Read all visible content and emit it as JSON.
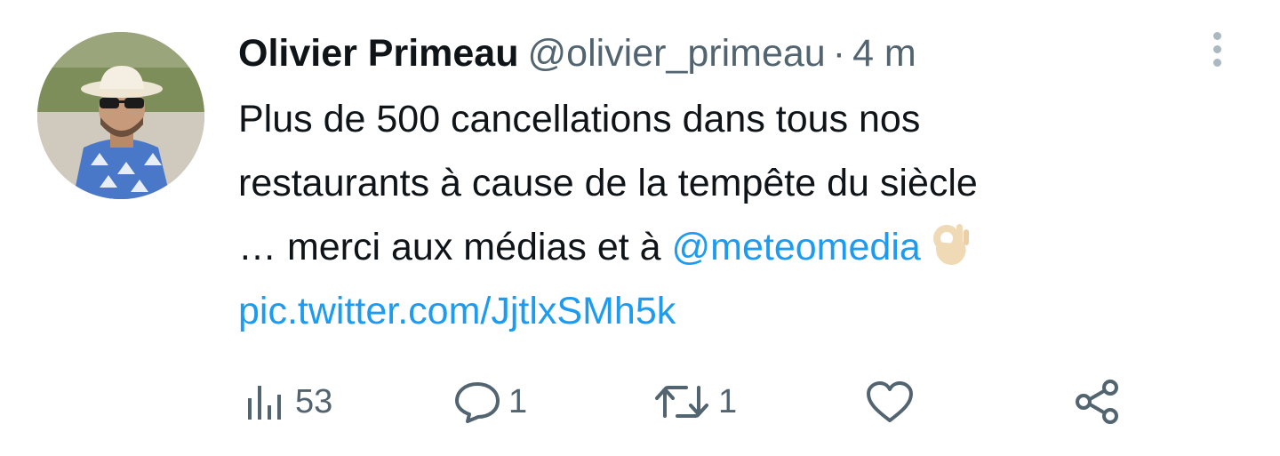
{
  "tweet": {
    "author_name": "Olivier Primeau",
    "handle": "@olivier_primeau",
    "separator": "·",
    "time": "4 m",
    "body": {
      "line1": "Plus de 500 cancellations dans tous nos",
      "line2": "restaurants à cause de la tempête du siècle",
      "line3_text": "… merci aux médias et à ",
      "mention": "@meteomedia",
      "emoji": "ok-hand-emoji",
      "pic_link": "pic.twitter.com/JjtlxSMh5k"
    }
  },
  "actions": {
    "views_count": "53",
    "reply_count": "1",
    "retweet_count": "1",
    "like_count": "",
    "share_count": ""
  },
  "icons": {
    "views": "bar-chart-icon",
    "reply": "speech-bubble-icon",
    "retweet": "retweet-arrows-icon",
    "like": "heart-icon",
    "share": "share-nodes-icon",
    "more": "vertical-ellipsis-icon"
  },
  "colors": {
    "text": "#0f1419",
    "secondary": "#536471",
    "link": "#1d9bf0",
    "more_dots": "#aab8c2"
  }
}
